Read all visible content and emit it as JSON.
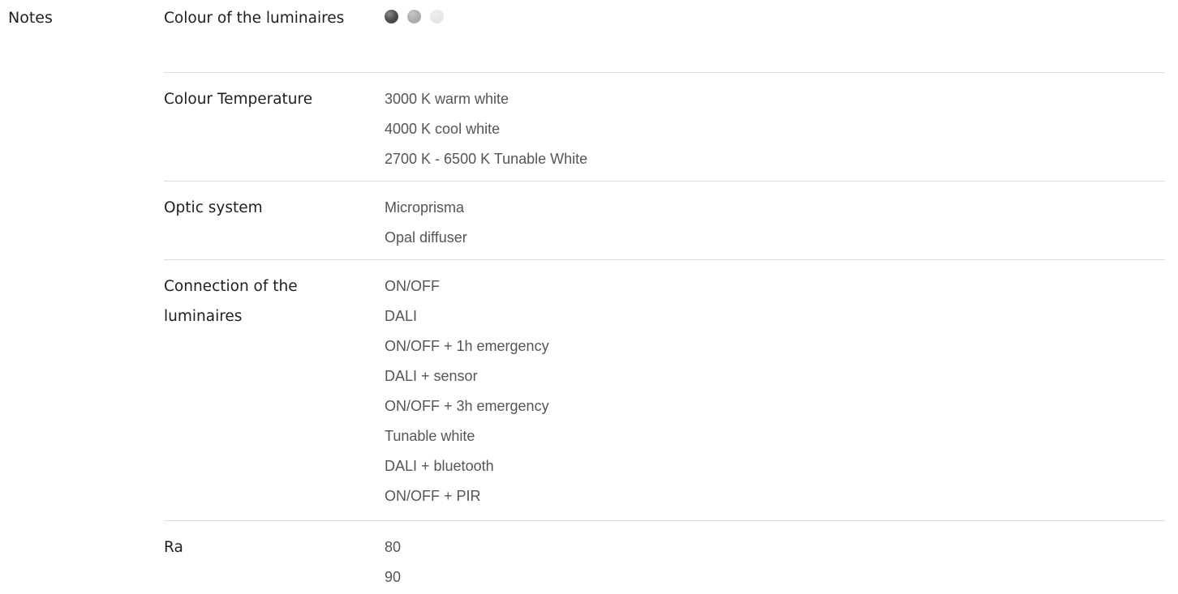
{
  "section": {
    "title": "Notes"
  },
  "colour_row": {
    "label": "Colour of the luminaires",
    "swatches": [
      {
        "name": "dark-grey",
        "color": "#4a4a4a"
      },
      {
        "name": "silver",
        "color": "#a9abae"
      },
      {
        "name": "white",
        "color": "#e6e6e6"
      }
    ]
  },
  "temperature_row": {
    "label": "Colour Temperature",
    "values": [
      "3000 K warm white",
      "4000 K cool white",
      "2700 K - 6500 K Tunable White"
    ]
  },
  "optic_row": {
    "label": "Optic system",
    "values": [
      "Microprisma",
      "Opal diffuser"
    ]
  },
  "connection_row": {
    "label": "Connection of the luminaires",
    "values": [
      "ON/OFF",
      "DALI",
      "ON/OFF + 1h emergency",
      "DALI + sensor",
      "ON/OFF + 3h emergency",
      "Tunable white",
      "DALI + bluetooth",
      "ON/OFF + PIR"
    ]
  },
  "ra_row": {
    "label": "Ra",
    "values": [
      "80",
      "90"
    ]
  }
}
